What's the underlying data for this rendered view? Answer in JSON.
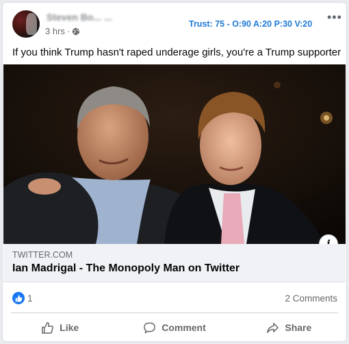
{
  "post": {
    "author": "Steven Bo... ...",
    "time": "3 hrs",
    "separator": "·",
    "privacy_icon": "globe-icon",
    "trust_badge": "Trust: 75 - O:90 A:20 P:30 V:20",
    "more_label": "•••",
    "text": "If you think Trump hasn't raped underage girls, you're a Trump supporter"
  },
  "link_preview": {
    "domain": "TWITTER.COM",
    "title": "Ian Madrigal - The Monopoly Man on Twitter",
    "info_label": "i"
  },
  "stats": {
    "reaction_icon": "like-icon",
    "reactions_count": "1",
    "comments_count": "2 Comments"
  },
  "actions": {
    "like_label": "Like",
    "comment_label": "Comment",
    "share_label": "Share"
  },
  "colors": {
    "accent": "#1877f2",
    "trust": "#1f7ad6",
    "muted": "#65676b"
  }
}
